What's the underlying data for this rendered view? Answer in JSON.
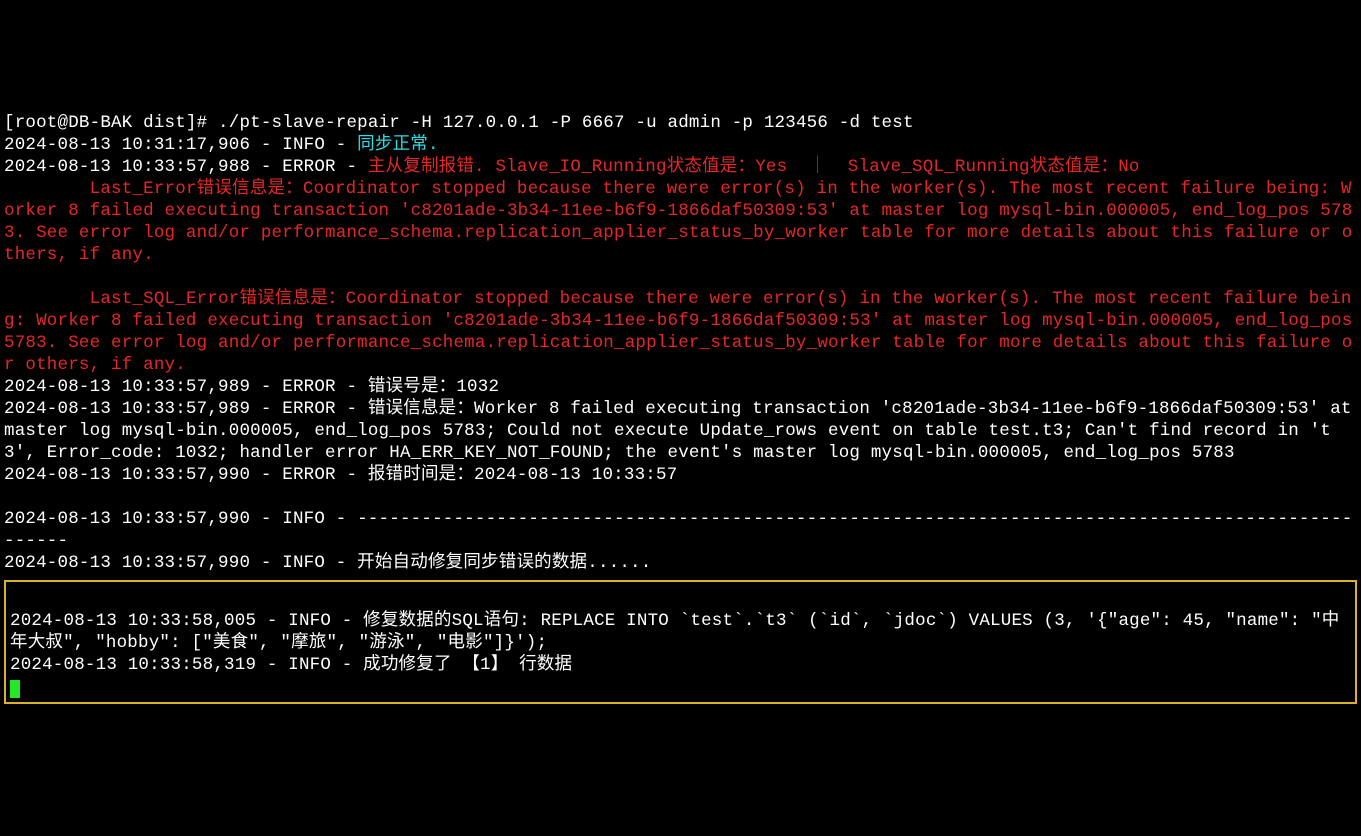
{
  "prompt": {
    "user_host": "[root@DB-BAK dist]# ",
    "command": "./pt-slave-repair -H 127.0.0.1 -P 6667 -u admin -p 123456 -d test"
  },
  "line_info1": {
    "ts": "2024-08-13 10:31:17,906 - INFO - ",
    "msg": "同步正常."
  },
  "line_err1": {
    "ts": "2024-08-13 10:33:57,988 - ERROR - ",
    "msg": "主从复制报错. Slave_IO_Running状态值是：Yes  ｜  Slave_SQL_Running状态值是：No"
  },
  "last_error": "        Last_Error错误信息是：Coordinator stopped because there were error(s) in the worker(s). The most recent failure being: Worker 8 failed executing transaction 'c8201ade-3b34-11ee-b6f9-1866daf50309:53' at master log mysql-bin.000005, end_log_pos 5783. See error log and/or performance_schema.replication_applier_status_by_worker table for more details about this failure or others, if any.",
  "last_sql_error": "        Last_SQL_Error错误信息是：Coordinator stopped because there were error(s) in the worker(s). The most recent failure being: Worker 8 failed executing transaction 'c8201ade-3b34-11ee-b6f9-1866daf50309:53' at master log mysql-bin.000005, end_log_pos 5783. See error log and/or performance_schema.replication_applier_status_by_worker table for more details about this failure or others, if any.",
  "line_err2": "2024-08-13 10:33:57,989 - ERROR - 错误号是：1032",
  "line_err3": "2024-08-13 10:33:57,989 - ERROR - 错误信息是：Worker 8 failed executing transaction 'c8201ade-3b34-11ee-b6f9-1866daf50309:53' at master log mysql-bin.000005, end_log_pos 5783; Could not execute Update_rows event on table test.t3; Can't find record in 't3', Error_code: 1032; handler error HA_ERR_KEY_NOT_FOUND; the event's master log mysql-bin.000005, end_log_pos 5783",
  "line_err4": "2024-08-13 10:33:57,990 - ERROR - 报错时间是：2024-08-13 10:33:57",
  "sep": "2024-08-13 10:33:57,990 - INFO - ---------------------------------------------------------------------------------------------------",
  "line_info2": "2024-08-13 10:33:57,990 - INFO - 开始自动修复同步错误的数据......",
  "box_line1": "2024-08-13 10:33:58,005 - INFO - 修复数据的SQL语句: REPLACE INTO `test`.`t3` (`id`, `jdoc`) VALUES (3, '{\"age\": 45, \"name\": \"中年大叔\", \"hobby\": [\"美食\", \"摩旅\", \"游泳\", \"电影\"]}');",
  "box_line2": "2024-08-13 10:33:58,319 - INFO - 成功修复了 【1】 行数据"
}
